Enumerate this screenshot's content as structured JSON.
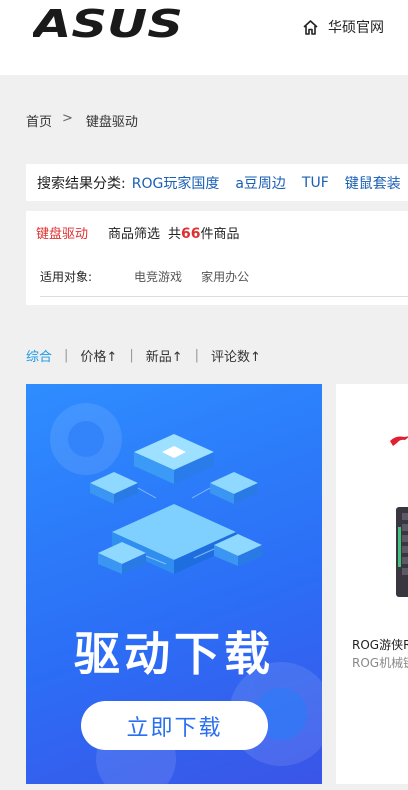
{
  "header": {
    "logo_text": "ASUS",
    "home_label": "华硕官网"
  },
  "breadcrumb": {
    "home": "首页",
    "separator": ">",
    "current": "键盘驱动"
  },
  "search_categories": {
    "label": "搜索结果分类:",
    "items": [
      "ROG玩家国度",
      "a豆周边",
      "TUF",
      "键鼠套装"
    ]
  },
  "filter_panel": {
    "active_tab": "键盘驱动",
    "filter_label": "商品筛选",
    "count_prefix": "共",
    "count": "66",
    "count_suffix": "件商品",
    "audience_label": "适用对象:",
    "audience_options": [
      "电竞游戏",
      "家用办公"
    ]
  },
  "sort": {
    "items": [
      {
        "label": "综合",
        "active": true
      },
      {
        "label": "价格↑",
        "active": false
      },
      {
        "label": "新品↑",
        "active": false
      },
      {
        "label": "评论数↑",
        "active": false
      }
    ],
    "separator": "|"
  },
  "banner": {
    "title": "驱动下载",
    "button": "立即下载"
  },
  "product_card": {
    "name": "ROG游侠R",
    "subtitle": "ROG机械键"
  },
  "colors": {
    "accent_blue": "#1a9be6",
    "link_blue": "#1a5fb4",
    "highlight_red": "#e03030",
    "banner_blue": "#2b6ff6"
  }
}
